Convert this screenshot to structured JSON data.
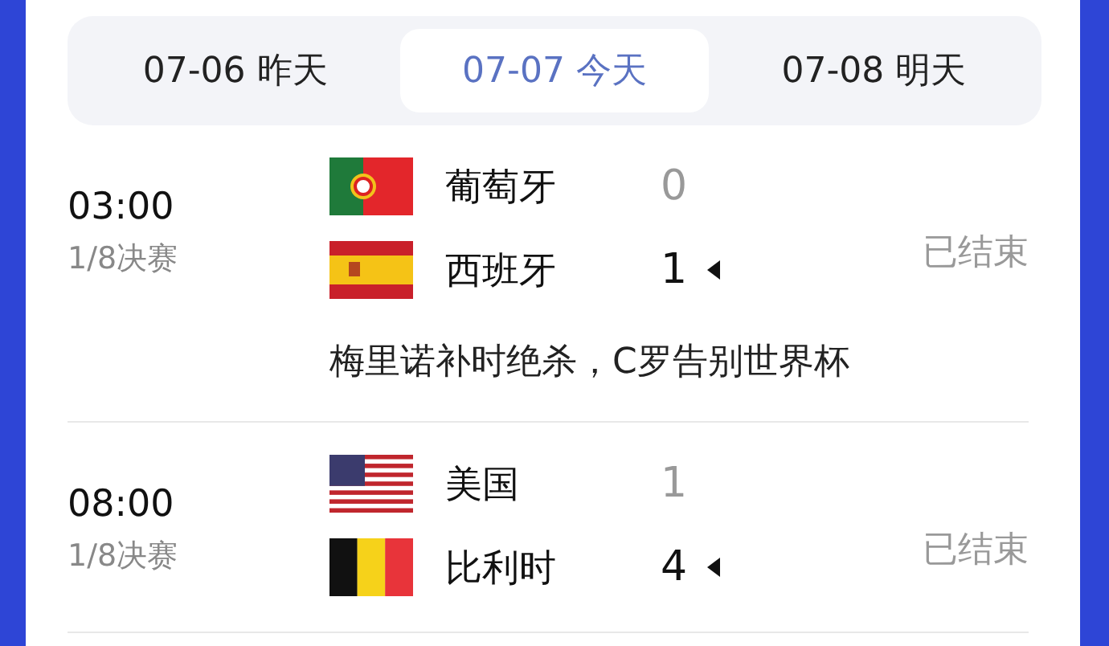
{
  "tabs": [
    {
      "label": "07-06 昨天",
      "selected": false
    },
    {
      "label": "07-07 今天",
      "selected": true
    },
    {
      "label": "07-08 明天",
      "selected": false
    }
  ],
  "matches": [
    {
      "time": "03:00",
      "round": "1/8决赛",
      "status": "已结束",
      "headline": "梅里诺补时绝杀，C罗告别世界杯",
      "teams": [
        {
          "name": "葡萄牙",
          "kind": "portugal",
          "score": "0",
          "winner": false
        },
        {
          "name": "西班牙",
          "kind": "spain",
          "score": "1",
          "winner": true
        }
      ]
    },
    {
      "time": "08:00",
      "round": "1/8决赛",
      "status": "已结束",
      "teams": [
        {
          "name": "美国",
          "kind": "usa",
          "score": "1",
          "winner": false
        },
        {
          "name": "比利时",
          "kind": "belgium",
          "score": "4",
          "winner": true
        }
      ]
    }
  ]
}
